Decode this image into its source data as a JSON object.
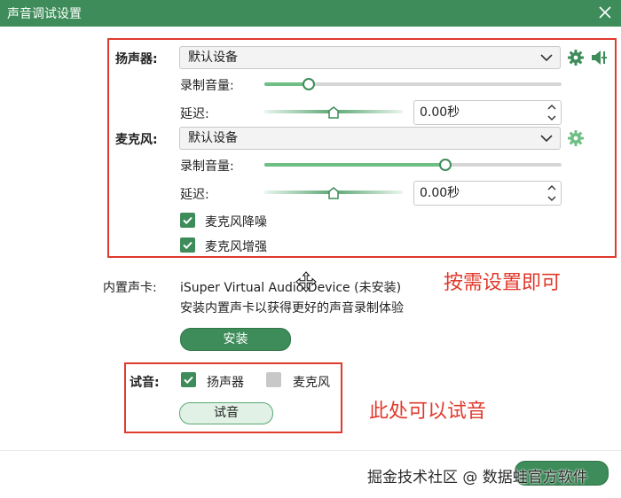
{
  "window": {
    "title": "声音调试设置"
  },
  "speaker": {
    "label": "扬声器:",
    "device": "默认设备",
    "record_volume_label": "录制音量:",
    "record_volume_level": 0.15,
    "delay_label": "延迟:",
    "delay_value": "0.00秒"
  },
  "microphone": {
    "label": "麦克风:",
    "device": "默认设备",
    "record_volume_label": "录制音量:",
    "record_volume_level": 0.61,
    "delay_label": "延迟:",
    "delay_value": "0.00秒",
    "noise_reduction": {
      "label": "麦克风降噪",
      "checked": true
    },
    "enhance": {
      "label": "麦克风增强",
      "checked": true
    }
  },
  "sound_card": {
    "label": "内置声卡:",
    "name": "iSuper Virtual Audio Device (未安装)",
    "description": "安装内置声卡以获得更好的声音录制体验",
    "install_label": "安装"
  },
  "test": {
    "label": "试音:",
    "speaker": {
      "label": "扬声器",
      "checked": true
    },
    "microphone": {
      "label": "麦克风",
      "checked": false
    },
    "button_label": "试音"
  },
  "annotations": {
    "top": "按需设置即可",
    "bottom": "此处可以试音"
  },
  "watermark": "掘金技术社区 @ 数据蛙官方软件",
  "colors": {
    "accent": "#3d8c5a",
    "slider_fill": "#6fbf85",
    "annotation": "#e03a2c"
  }
}
